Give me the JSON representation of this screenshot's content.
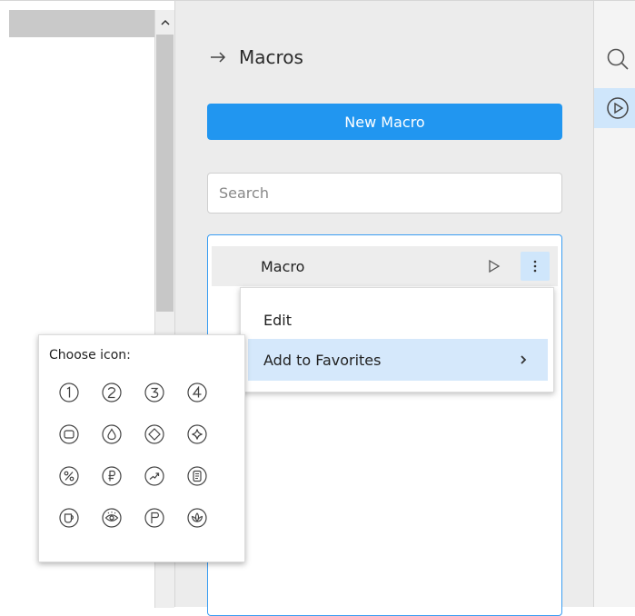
{
  "panel": {
    "title": "Macros",
    "new_macro_label": "New Macro",
    "search_placeholder": "Search"
  },
  "macros": [
    {
      "name": "Macro"
    }
  ],
  "context_menu": {
    "items": [
      {
        "label": "Edit"
      },
      {
        "label": "Add to Favorites",
        "has_submenu": true
      }
    ]
  },
  "icon_chooser": {
    "title": "Choose icon:",
    "icons": [
      "number-1-icon",
      "number-2-icon",
      "number-3-icon",
      "number-4-icon",
      "square-icon",
      "drop-icon",
      "diamond-icon",
      "sparkle-icon",
      "percent-icon",
      "ruble-icon",
      "trend-arrow-icon",
      "document-icon",
      "cup-icon",
      "eye-icon",
      "flag-icon",
      "lotus-icon"
    ]
  },
  "colors": {
    "accent": "#2196f0",
    "selection": "#d5e8fb",
    "panel_bg": "#ececec"
  }
}
